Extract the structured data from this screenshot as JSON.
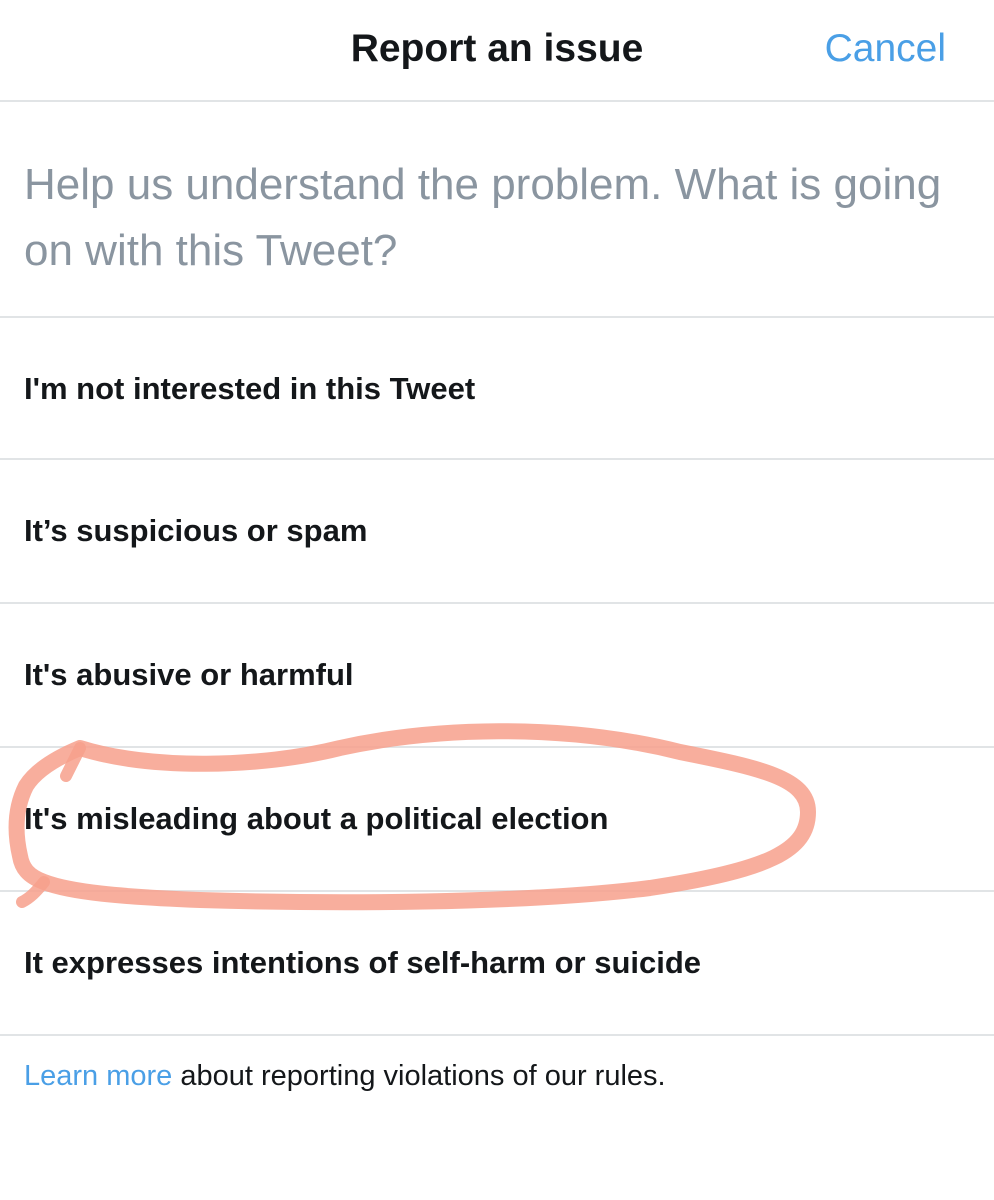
{
  "header": {
    "title": "Report an issue",
    "cancel_label": "Cancel"
  },
  "prompt": "Help us understand the problem. What is going on with this Tweet?",
  "options": [
    {
      "label": "I'm not interested in this Tweet"
    },
    {
      "label": "It’s suspicious or spam"
    },
    {
      "label": "It's abusive or harmful"
    },
    {
      "label": "It's misleading about a political election"
    },
    {
      "label": "It expresses intentions of self-harm or suicide"
    }
  ],
  "footer": {
    "link_text": "Learn more",
    "text": " about reporting violations of our rules."
  },
  "colors": {
    "accent": "#4a9fe6",
    "prompt_text": "#8a95a0",
    "divider": "#e1e4e6",
    "annotation_stroke": "#f7a08c"
  }
}
